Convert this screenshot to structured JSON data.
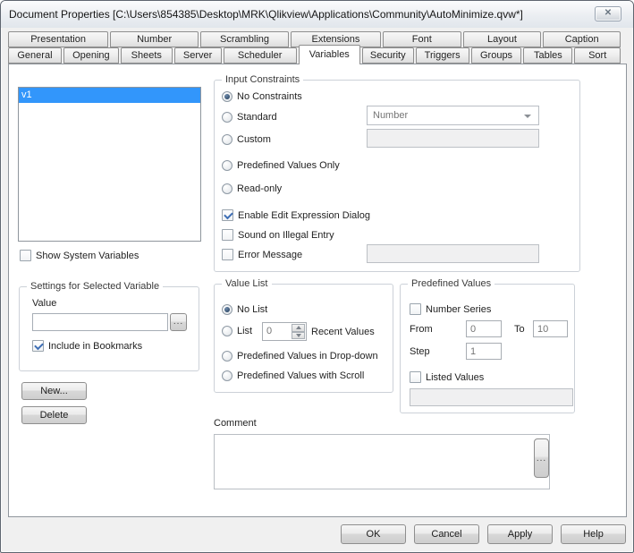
{
  "window": {
    "title": "Document Properties [C:\\Users\\854385\\Desktop\\MRK\\Qlikview\\Applications\\Community\\AutoMinimize.qvw*]",
    "close_glyph": "✕"
  },
  "tabs": {
    "row1": [
      "Presentation",
      "Number",
      "Scrambling",
      "Extensions",
      "Font",
      "Layout",
      "Caption"
    ],
    "row2": [
      "General",
      "Opening",
      "Sheets",
      "Server",
      "Scheduler",
      "Variables",
      "Security",
      "Triggers",
      "Groups",
      "Tables",
      "Sort"
    ],
    "active_tab": "Variables"
  },
  "variables_panel": {
    "list": [
      "v1"
    ],
    "selected_item": "v1",
    "show_system_variables": {
      "label": "Show System Variables",
      "checked": false
    }
  },
  "settings_group": {
    "title": "Settings for Selected Variable",
    "value_label": "Value",
    "value_input": "",
    "browse_label": "...",
    "include_in_bookmarks": {
      "label": "Include in Bookmarks",
      "checked": true
    }
  },
  "side_buttons": {
    "new": "New...",
    "delete": "Delete"
  },
  "input_constraints": {
    "title": "Input Constraints",
    "options": [
      {
        "label": "No Constraints",
        "selected": true
      },
      {
        "label": "Standard",
        "selected": false,
        "dropdown_value": "Number"
      },
      {
        "label": "Custom",
        "selected": false,
        "field_value": ""
      },
      {
        "label": "Predefined Values Only",
        "selected": false
      },
      {
        "label": "Read-only",
        "selected": false
      }
    ],
    "checkboxes": [
      {
        "label": "Enable Edit Expression Dialog",
        "checked": true
      },
      {
        "label": "Sound on Illegal Entry",
        "checked": false
      },
      {
        "label": "Error Message",
        "checked": false,
        "field_value": ""
      }
    ]
  },
  "value_list": {
    "title": "Value List",
    "options": [
      {
        "label": "No List",
        "selected": true
      },
      {
        "label": "List",
        "selected": false,
        "spinner_value": "0",
        "suffix": "Recent Values"
      },
      {
        "label": "Predefined Values in Drop-down",
        "selected": false
      },
      {
        "label": "Predefined Values with Scroll",
        "selected": false
      }
    ]
  },
  "predefined_values": {
    "title": "Predefined Values",
    "number_series": {
      "label": "Number Series",
      "checked": false
    },
    "from_label": "From",
    "from_value": "0",
    "to_label": "To",
    "to_value": "10",
    "step_label": "Step",
    "step_value": "1",
    "listed_values": {
      "label": "Listed Values",
      "checked": false
    },
    "listed_field_value": ""
  },
  "comment": {
    "label": "Comment",
    "value": "",
    "browse_label": "..."
  },
  "footer_buttons": {
    "ok": "OK",
    "cancel": "Cancel",
    "apply": "Apply",
    "help": "Help"
  }
}
